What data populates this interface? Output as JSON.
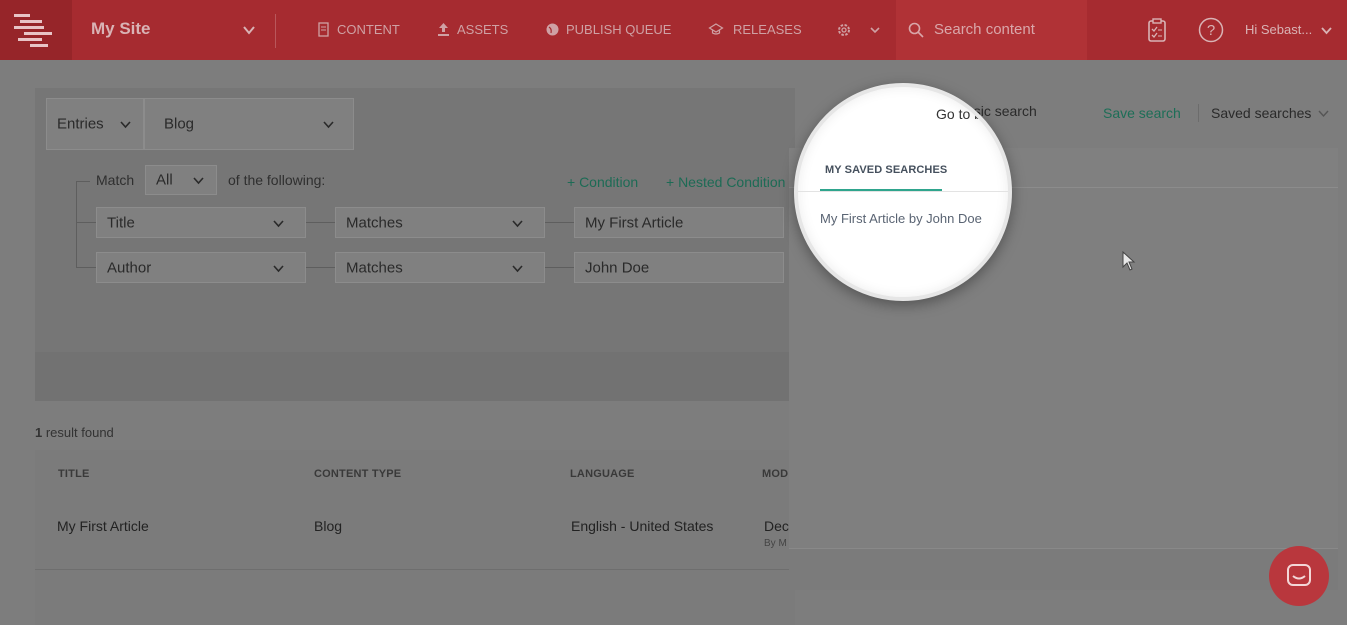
{
  "topbar": {
    "site_name": "My Site",
    "nav": [
      {
        "label": "CONTENT",
        "icon": "document-icon"
      },
      {
        "label": "ASSETS",
        "icon": "upload-icon"
      },
      {
        "label": "PUBLISH QUEUE",
        "icon": "globe-icon"
      },
      {
        "label": "RELEASES",
        "icon": "graduation-cap-icon"
      }
    ],
    "search_placeholder": "Search content",
    "user_greeting": "Hi  Sebast...",
    "colors": {
      "bar": "#a62b30",
      "logo_cell": "#962529",
      "search": "#b03236"
    }
  },
  "filters": {
    "scope": "Entries",
    "content_type": "Blog",
    "match_label": "Match",
    "match_value": "All",
    "of_following": "of the following:",
    "add_condition": "+ Condition",
    "add_nested": "+ Nested Condition",
    "conditions": [
      {
        "field": "Title",
        "operator": "Matches",
        "value": "My First Article"
      },
      {
        "field": "Author",
        "operator": "Matches",
        "value": "John Doe"
      }
    ]
  },
  "results": {
    "count": "1",
    "count_suffix": " result found",
    "columns": [
      "TITLE",
      "CONTENT TYPE",
      "LANGUAGE",
      "MOD"
    ],
    "rows": [
      {
        "title": "My First Article",
        "content_type": "Blog",
        "language": "English - United States",
        "modified": "Dec",
        "modified_by": "By M"
      }
    ]
  },
  "search_actions": {
    "go_basic": "Go to basic search",
    "save_search": "Save search",
    "saved_searches": "Saved searches"
  },
  "saved_panel": {
    "tab": "MY SAVED SEARCHES",
    "items": [
      "My First Article by John Doe"
    ],
    "accent": "#2fa58d"
  }
}
